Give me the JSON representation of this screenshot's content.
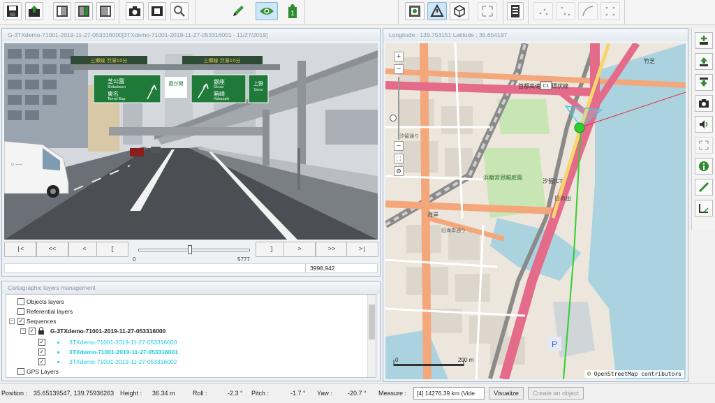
{
  "video": {
    "title": "G-3TXdemo-71001-2019-11-27-053316000[3TXdemo-71001-2019-11-27-053316001 - 11/27/2019]",
    "controls": [
      "|<",
      "<<",
      "<",
      "[",
      "]",
      ">",
      ">>",
      ">|"
    ],
    "slider": {
      "min": "0",
      "max": "5777",
      "position": 0.46
    },
    "position_readout": "3998,942",
    "signs": [
      "芝公園",
      "Shibakoen",
      "東名",
      "Tomei Exp",
      "霞が関",
      "銀座",
      "Ginza",
      "箱崎",
      "Hakozaki",
      "上野",
      "Ueno"
    ]
  },
  "map": {
    "title": "Longitude : 139.753151  Latitude : 35.654197",
    "labels": [
      "首都高速都心環状線",
      "汐留JCT",
      "浜離宮恩賜庭園",
      "日の出",
      "竹芝",
      "海岸",
      "汐留通り",
      "旧海岸通り",
      "C1"
    ],
    "attribution": "© OpenStreetMap contributors",
    "scale": "200 m"
  },
  "layers": {
    "title": "Cartographic layers management",
    "items": [
      {
        "label": "Objects layers",
        "checked": false,
        "indent": 0,
        "style": "normal"
      },
      {
        "label": "Referential layers",
        "checked": false,
        "indent": 0,
        "style": "normal"
      },
      {
        "label": "Sequences",
        "checked": true,
        "indent": 0,
        "style": "normal",
        "expander": "−"
      },
      {
        "label": "G-3TXdemo-71001-2019-11-27-053316000",
        "checked": true,
        "indent": 1,
        "style": "bold",
        "expander": "−",
        "lock": true
      },
      {
        "label": "3TXdemo-71001-2019-11-27-053316000",
        "checked": true,
        "indent": 2,
        "style": "cyan"
      },
      {
        "label": "3TXdemo-71001-2019-11-27-053316001",
        "checked": true,
        "indent": 2,
        "style": "cyan-bold"
      },
      {
        "label": "3TXdemo-71001-2019-11-27-053316002",
        "checked": true,
        "indent": 2,
        "style": "cyan"
      },
      {
        "label": "GPS Layers",
        "checked": false,
        "indent": 0,
        "style": "normal"
      }
    ]
  },
  "status": {
    "position_label": "Position :",
    "position_value": "35.65139547, 139.75936263",
    "height_label": "Height :",
    "height_value": "36.34 m",
    "roll_label": "Roll :",
    "roll_value": "-2.3 °",
    "pitch_label": "Pitch :",
    "pitch_value": "-1.7 °",
    "yaw_label": "Yaw :",
    "yaw_value": "-20.7 °",
    "measure_label": "Measure :",
    "measure_value": "[4] 14276.39 km (Vide",
    "visualize_button": "Visualize",
    "create_object_button": "Create an object"
  },
  "toolbar_icons": [
    "save-icon",
    "export-icon",
    "layout-left-icon",
    "layout-center-icon",
    "layout-right-icon",
    "camera-icon",
    "film-icon",
    "zoom-icon",
    "pencil-icon",
    "eye-icon",
    "info-marker-icon",
    "map-point-icon",
    "warning-icon",
    "cube-icon",
    "expand-icon",
    "list-icon",
    "points-icon",
    "points-corner-icon",
    "curve-icon",
    "points-grid-icon"
  ],
  "colors": {
    "accent": "#2e8b2e",
    "highway": "#e56b8a",
    "water": "#aad3df",
    "park": "#c8e6b4",
    "trajectory": "#2ecf2e"
  }
}
